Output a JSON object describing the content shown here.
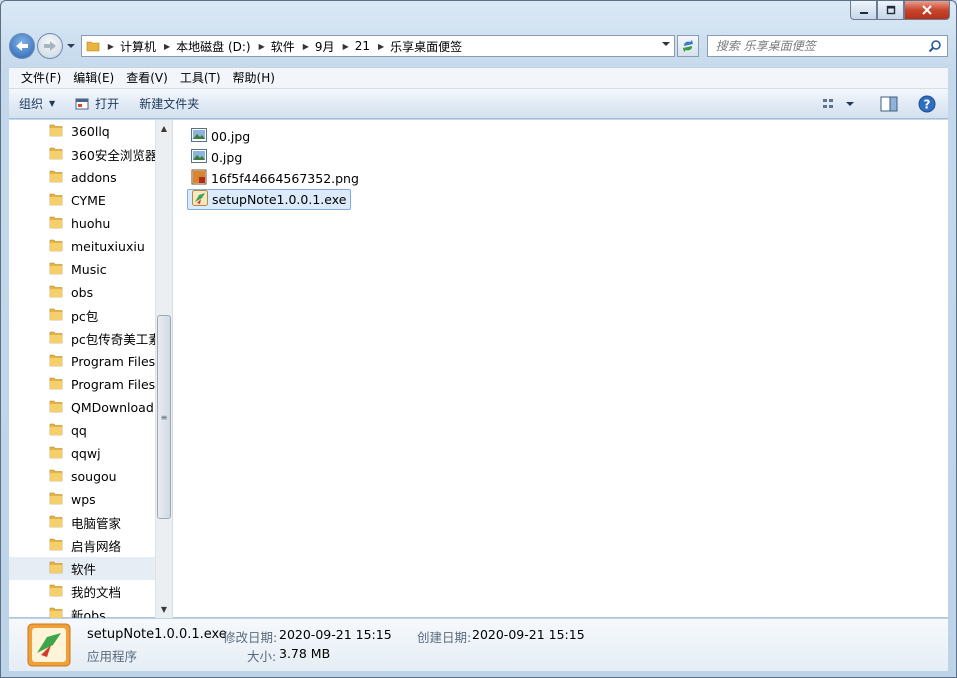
{
  "address": {
    "crumbs": [
      "计算机",
      "本地磁盘 (D:)",
      "软件",
      "9月",
      "21",
      "乐享桌面便签"
    ]
  },
  "search": {
    "placeholder": "搜索 乐享桌面便签"
  },
  "menu": [
    "文件(F)",
    "编辑(E)",
    "查看(V)",
    "工具(T)",
    "帮助(H)"
  ],
  "toolbar": {
    "organize": "组织",
    "open": "打开",
    "new_folder": "新建文件夹"
  },
  "tree": [
    "360llq",
    "360安全浏览器",
    "addons",
    "CYME",
    "huohu",
    "meituxiuxiu",
    "Music",
    "obs",
    "pc包",
    "pc包传奇美工素",
    "Program Files",
    "Program Files",
    "QMDownload",
    "qq",
    "qqwj",
    "sougou",
    "wps",
    "电脑管家",
    "启肯网络",
    "软件",
    "我的文档",
    "新obs"
  ],
  "tree_selected_index": 19,
  "files": [
    {
      "name": "00.jpg",
      "icon": "jpg-image-icon"
    },
    {
      "name": "0.jpg",
      "icon": "jpg-image-icon"
    },
    {
      "name": "16f5f44664567352.png",
      "icon": "png-image-icon"
    },
    {
      "name": "setupNote1.0.0.1.exe",
      "icon": "exe-app-icon",
      "selected": true
    }
  ],
  "details": {
    "name": "setupNote1.0.0.1.exe",
    "type": "应用程序",
    "modified_label": "修改日期:",
    "modified_value": "2020-09-21 15:15",
    "created_label": "创建日期:",
    "created_value": "2020-09-21 15:15",
    "size_label": "大小:",
    "size_value": "3.78 MB"
  },
  "colors": {
    "accent": "#2a64b4",
    "selection": "#dcebfc",
    "folder": "#e8b43c"
  }
}
